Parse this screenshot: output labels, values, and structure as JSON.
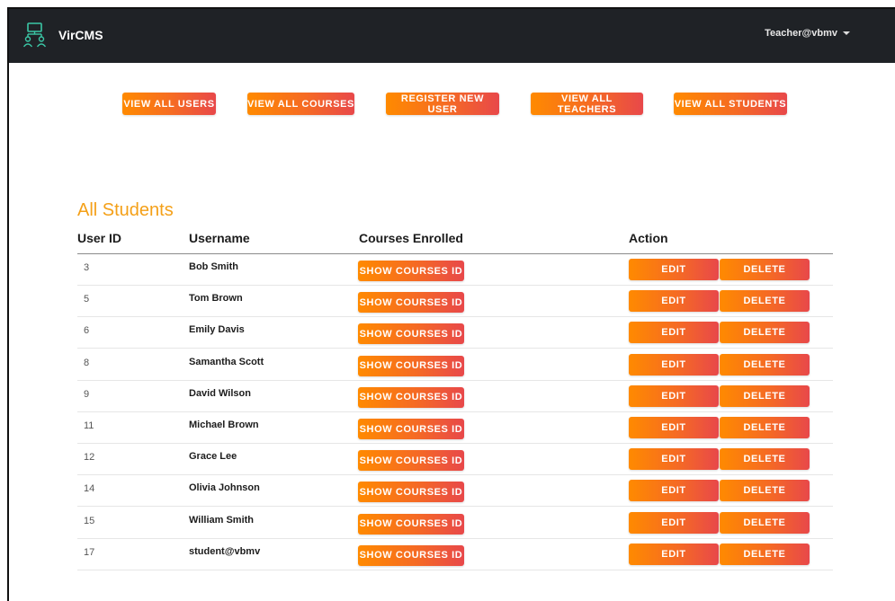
{
  "app": {
    "brand_name": "VirCMS",
    "user_menu_label": "Teacher@vbmv"
  },
  "toolbar": {
    "view_all_users": "VIEW ALL USERS",
    "view_all_courses": "VIEW ALL COURSES",
    "register_new_user": "REGISTER NEW USER",
    "view_all_teachers": "VIEW ALL TEACHERS",
    "view_all_students": "VIEW ALL STUDENTS"
  },
  "page": {
    "title": "All Students"
  },
  "table": {
    "columns": [
      "User ID",
      "Username",
      "Courses Enrolled",
      "Action"
    ],
    "show_courses_label": "SHOW COURSES ID",
    "edit_label": "EDIT",
    "delete_label": "DELETE",
    "rows": [
      {
        "id": "3",
        "username": "Bob Smith"
      },
      {
        "id": "5",
        "username": "Tom Brown"
      },
      {
        "id": "6",
        "username": "Emily Davis"
      },
      {
        "id": "8",
        "username": "Samantha Scott"
      },
      {
        "id": "9",
        "username": "David Wilson"
      },
      {
        "id": "11",
        "username": "Michael Brown"
      },
      {
        "id": "12",
        "username": "Grace Lee"
      },
      {
        "id": "14",
        "username": "Olivia Johnson"
      },
      {
        "id": "15",
        "username": "William Smith"
      },
      {
        "id": "17",
        "username": "student@vbmv"
      }
    ]
  },
  "icons": {
    "brand": "network-users-icon",
    "user_menu": "chevron-down-icon"
  },
  "colors": {
    "navbar": "#1f2226",
    "accent_start": "#ff8a00",
    "accent_end": "#e8484a",
    "heading": "#f4a018"
  }
}
